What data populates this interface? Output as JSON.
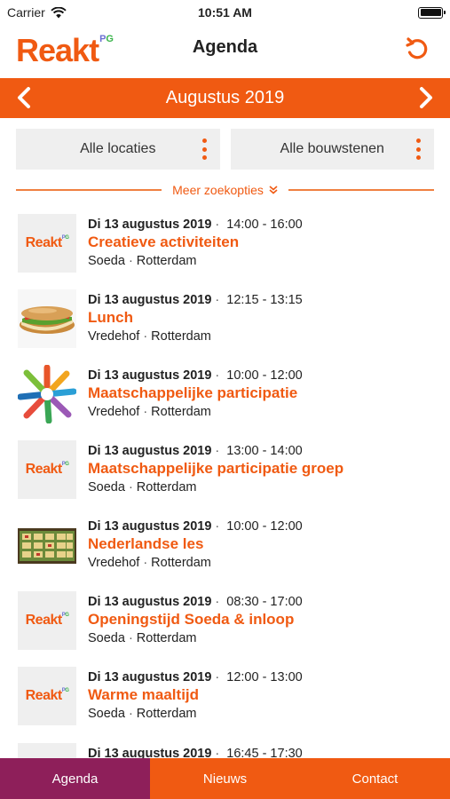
{
  "status_bar": {
    "carrier": "Carrier",
    "time": "10:51 AM"
  },
  "header": {
    "logo": "Reakt",
    "logo_sup_p": "P",
    "logo_sup_g": "G",
    "title": "Agenda"
  },
  "month_nav": {
    "label": "Augustus 2019"
  },
  "filters": {
    "locations": "Alle locaties",
    "building_blocks": "Alle bouwstenen"
  },
  "more_options": {
    "label": "Meer zoekopties"
  },
  "events": [
    {
      "date": "Di 13 augustus 2019",
      "time": "14:00 - 16:00",
      "title": "Creatieve activiteiten",
      "location": "Soeda",
      "city": "Rotterdam",
      "thumb": "reakt-logo"
    },
    {
      "date": "Di 13 augustus 2019",
      "time": "12:15 - 13:15",
      "title": "Lunch",
      "location": "Vredehof",
      "city": "Rotterdam",
      "thumb": "sandwich-photo"
    },
    {
      "date": "Di 13 augustus 2019",
      "time": "10:00 - 12:00",
      "title": "Maatschappelijke participatie",
      "location": "Vredehof",
      "city": "Rotterdam",
      "thumb": "hands-circle-illustration"
    },
    {
      "date": "Di 13 augustus 2019",
      "time": "13:00 - 14:00",
      "title": "Maatschappelijke participatie groep",
      "location": "Soeda",
      "city": "Rotterdam",
      "thumb": "reakt-logo"
    },
    {
      "date": "Di 13 augustus 2019",
      "time": "10:00 - 12:00",
      "title": "Nederlandse les",
      "location": "Vredehof",
      "city": "Rotterdam",
      "thumb": "classroom-board-photo"
    },
    {
      "date": "Di 13 augustus 2019",
      "time": "08:30 - 17:00",
      "title": "Openingstijd Soeda & inloop",
      "location": "Soeda",
      "city": "Rotterdam",
      "thumb": "reakt-logo"
    },
    {
      "date": "Di 13 augustus 2019",
      "time": "12:00 - 13:00",
      "title": "Warme maaltijd",
      "location": "Soeda",
      "city": "Rotterdam",
      "thumb": "reakt-logo"
    },
    {
      "date": "Di 13 augustus 2019",
      "time": "16:45 - 17:30",
      "title": "",
      "location": "",
      "city": "",
      "thumb": "reakt-logo"
    }
  ],
  "tabs": [
    {
      "label": "Agenda",
      "active": true
    },
    {
      "label": "Nieuws",
      "active": false
    },
    {
      "label": "Contact",
      "active": false
    }
  ],
  "colors": {
    "brand_orange": "#f05a12",
    "tab_active": "#8e1f5a",
    "filter_bg": "#efefef"
  }
}
